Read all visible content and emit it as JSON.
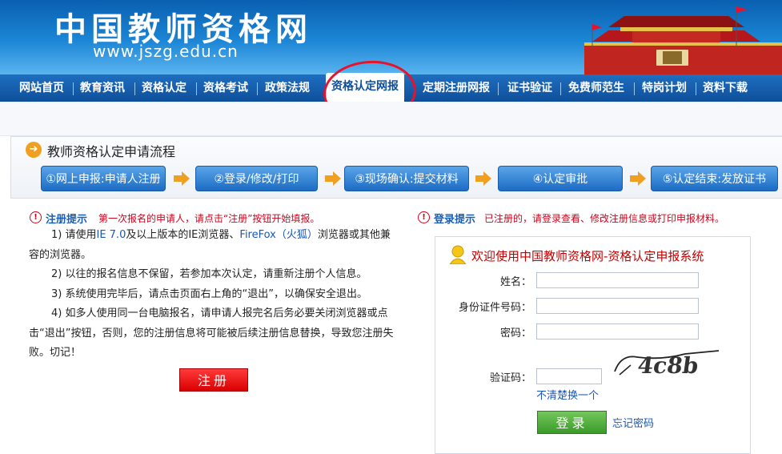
{
  "header": {
    "site_title": "中国教师资格网",
    "site_url": "www.jszg.edu.cn"
  },
  "nav": {
    "items": [
      "网站首页",
      "教育资讯",
      "资格认定",
      "资格考试",
      "政策法规",
      "资格认定网报",
      "定期注册网报",
      "证书验证",
      "免费师范生",
      "特岗计划",
      "资料下载"
    ],
    "active": "资格认定网报"
  },
  "process": {
    "title": "教师资格认定申请流程",
    "steps": [
      "①网上申报:申请人注册",
      "②登录/修改/打印",
      "③现场确认:提交材料",
      "④认定审批",
      "⑤认定结束:发放证书"
    ]
  },
  "register_notice": {
    "title": "注册提示",
    "tip": "第一次报名的申请人，请点击“注册”按钮开始填报。",
    "line1_pre": "1) 请使用",
    "line1_ie": "IE 7.0",
    "line1_mid": "及以上版本的IE浏览器、",
    "line1_ff": "FireFox（火狐）",
    "line1_post": "浏览器或其他兼容的浏览器。",
    "line2": "2) 以往的报名信息不保留，若参加本次认定，请重新注册个人信息。",
    "line3": "3) 系统使用完毕后，请点击页面右上角的“退出”，以确保安全退出。",
    "line4": "4) 如多人使用同一台电脑报名，请申请人报完名后务必要关闭浏览器或点击“退出”按钮，否则，您的注册信息将可能被后续注册信息替换，导致您注册失败。切记！",
    "register_button": "注册"
  },
  "login_notice": {
    "title": "登录提示",
    "tip": "已注册的，请登录查看、修改注册信息或打印申报材料。"
  },
  "login": {
    "title": "欢迎使用中国教师资格网-资格认定申报系统",
    "name_label": "姓名：",
    "id_label": "身份证件号码：",
    "password_label": "密码：",
    "captcha_label": "验证码：",
    "captcha_text": "4c8b",
    "refresh_link": "不清楚换一个",
    "login_button": "登录",
    "forgot_link": "忘记密码"
  },
  "colors": {
    "nav_blue": "#0e4f9a",
    "link_blue": "#1a56b8",
    "alert_red": "#d0021b",
    "highlight_circle": "#e8132a",
    "login_green": "#3b9a2a"
  }
}
